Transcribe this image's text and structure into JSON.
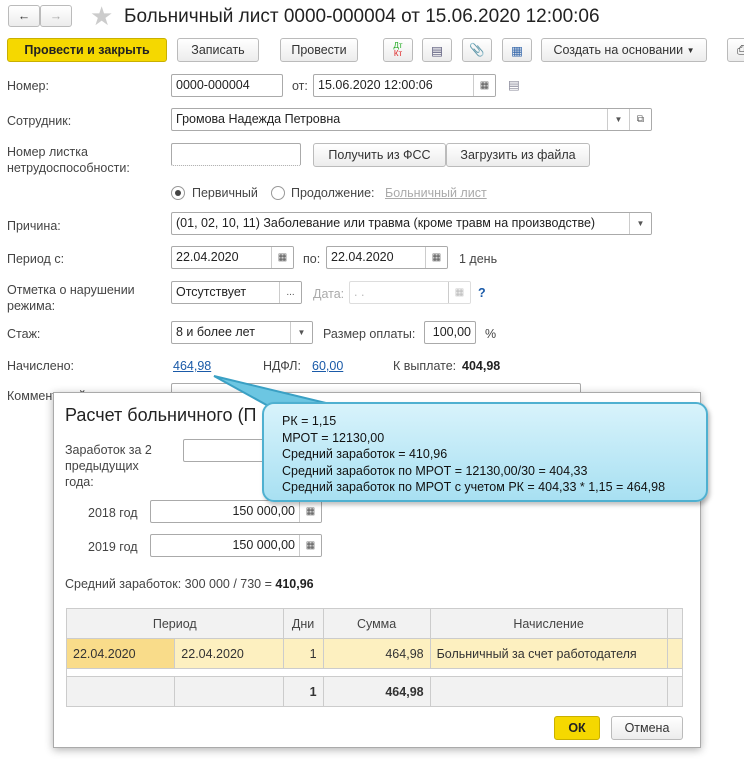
{
  "header": {
    "title": "Больничный лист 0000-000004 от 15.06.2020 12:00:06"
  },
  "toolbar": {
    "post_close": "Провести и закрыть",
    "save": "Записать",
    "post": "Провести",
    "dtkt_dt": "Дт",
    "dtkt_kt": "Кт",
    "create_based": "Создать на основании"
  },
  "form": {
    "number_label": "Номер:",
    "number": "0000-000004",
    "from_label": "от:",
    "date": "15.06.2020 12:00:06",
    "employee_label": "Сотрудник:",
    "employee": "Громова Надежда Петровна",
    "sheet_label": "Номер листка нетрудоспособности:",
    "sheet_value": "",
    "get_fss": "Получить из ФСС",
    "load_file": "Загрузить из файла",
    "primary": "Первичный",
    "continuation": "Продолжение:",
    "sick_link": "Больничный лист",
    "reason_label": "Причина:",
    "reason": "(01, 02, 10, 11) Заболевание или травма (кроме травм на производстве)",
    "period_label": "Период с:",
    "period_from": "22.04.2020",
    "to_label": "по:",
    "period_to": "22.04.2020",
    "days": "1 день",
    "violation_label": "Отметка о нарушении режима:",
    "violation": "Отсутствует",
    "date_label": "Дата:",
    "date_value": " .  .",
    "help": "?",
    "experience_label": "Стаж:",
    "experience": "8 и более лет",
    "pay_label": "Размер оплаты:",
    "pay": "100,00",
    "percent": "%",
    "accrued_label": "Начислено:",
    "accrued": "464,98",
    "ndfl_label": "НДФЛ:",
    "ndfl": "60,00",
    "payout_label": "К выплате:",
    "payout": "404,98",
    "comment_label": "Комментарий:"
  },
  "dialog": {
    "title": "Расчет больничного (П",
    "earnings_label": "Заработок за 2 предыдущих года:",
    "years_field": "201",
    "year1_label": "2018 год",
    "year1": "150 000,00",
    "year2_label": "2019 год",
    "year2": "150 000,00",
    "avg_text": "Средний заработок: 300 000 / 730 = ",
    "avg_value": "410,96",
    "columns": [
      "Период",
      "Дни",
      "Сумма",
      "Начисление"
    ],
    "row": {
      "from": "22.04.2020",
      "to": "22.04.2020",
      "days": "1",
      "sum": "464,98",
      "type": "Больничный за счет работодателя"
    },
    "total": {
      "days": "1",
      "sum": "464,98"
    },
    "ok": "ОК",
    "cancel": "Отмена"
  },
  "callout": {
    "lines": [
      "РК = 1,15",
      "МРОТ = 12130,00",
      "Средний заработок = 410,96",
      "Средний заработок по МРОТ = 12130,00/30 = 404,33",
      "Средний заработок по МРОТ с учетом РК = 404,33 * 1,15 = 464,98"
    ]
  },
  "colors": {
    "primary_button": "#f5d800",
    "link": "#1a5aa8",
    "row_highlight": "#fdf0c0",
    "callout": "#a8e0f2"
  }
}
